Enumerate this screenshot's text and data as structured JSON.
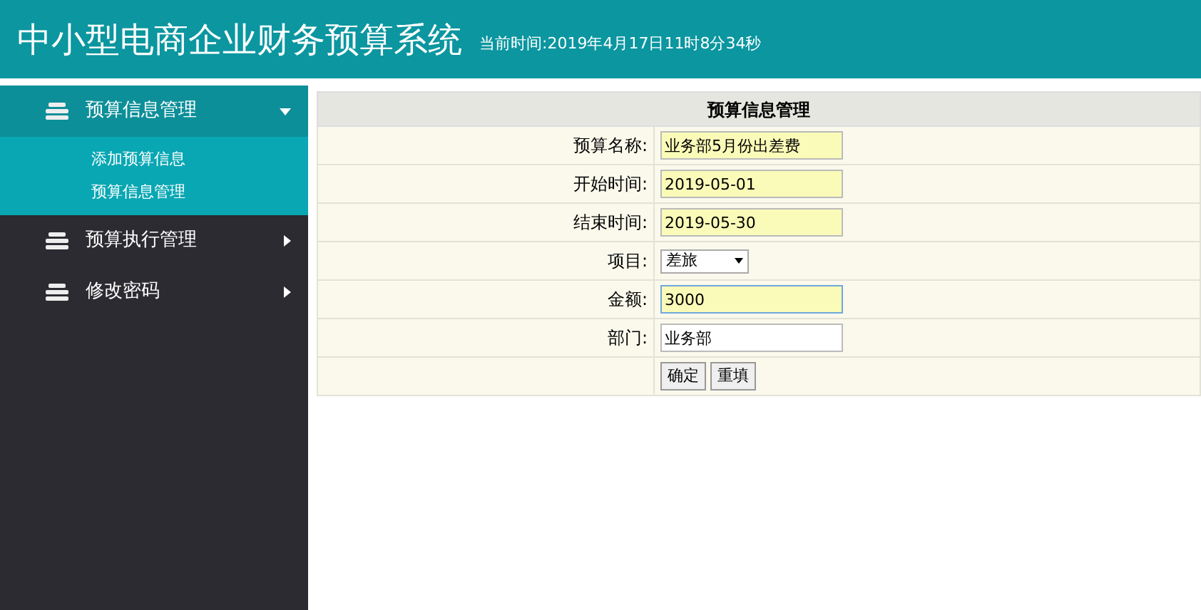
{
  "header": {
    "title": "中小型电商企业财务预算系统",
    "time": "当前时间:2019年4月17日11时8分34秒"
  },
  "sidebar": {
    "items": [
      {
        "label": "预算信息管理",
        "expanded": true,
        "children": [
          {
            "label": "添加预算信息"
          },
          {
            "label": "预算信息管理"
          }
        ]
      },
      {
        "label": "预算执行管理",
        "expanded": false
      },
      {
        "label": "修改密码",
        "expanded": false
      }
    ]
  },
  "form": {
    "title": "预算信息管理",
    "fields": [
      {
        "kind": "text",
        "label": "预算名称:",
        "value": "业务部5月份出差费",
        "autofilled": true,
        "focused": false
      },
      {
        "kind": "text",
        "label": "开始时间:",
        "value": "2019-05-01",
        "autofilled": true,
        "focused": false
      },
      {
        "kind": "text",
        "label": "结束时间:",
        "value": "2019-05-30",
        "autofilled": true,
        "focused": false
      },
      {
        "kind": "select",
        "label": "项目:",
        "value": "差旅"
      },
      {
        "kind": "text",
        "label": "金额:",
        "value": "3000",
        "autofilled": true,
        "focused": true
      },
      {
        "kind": "text",
        "label": "部门:",
        "value": "业务部",
        "autofilled": false,
        "focused": false
      }
    ],
    "buttons": [
      "确定",
      "重填"
    ]
  }
}
